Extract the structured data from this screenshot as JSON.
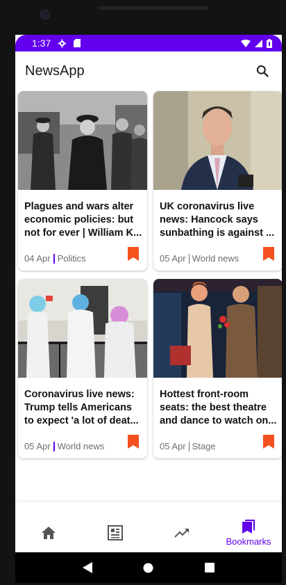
{
  "status_bar": {
    "time": "1:37",
    "icons": [
      "settings-icon",
      "sd-card-icon",
      "wifi-icon",
      "signal-icon",
      "battery-icon"
    ],
    "background": "#6200ee"
  },
  "app_bar": {
    "title": "NewsApp",
    "search_icon": "search-icon"
  },
  "articles": [
    {
      "title": "Plagues and wars alter economic policies: but not for ever | William K...",
      "date": "04 Apr",
      "category": "Politics",
      "image": "black-and-white photo of people in coats and hats",
      "bookmark_icon": "bookmark-icon"
    },
    {
      "title": "UK coronavirus live news: Hancock says sunbathing is against ...",
      "date": "05 Apr",
      "category": "World news",
      "image": "man in suit speaking outdoors",
      "bookmark_icon": "bookmark-icon"
    },
    {
      "title": "Coronavirus live news: Trump tells Americans to expect 'a lot of deat...",
      "date": "05 Apr",
      "category": "World news",
      "image": "workers in white protective suits sitting outside a building",
      "bookmark_icon": "bookmark-icon"
    },
    {
      "title": "Hottest front-room seats: the best theatre and dance to watch on...",
      "date": "05 Apr",
      "category": "Stage",
      "image": "two actors performing on a stage",
      "bookmark_icon": "bookmark-icon"
    }
  ],
  "bottom_nav": {
    "items": [
      {
        "icon": "home-icon",
        "label": ""
      },
      {
        "icon": "newspaper-icon",
        "label": ""
      },
      {
        "icon": "trending-icon",
        "label": ""
      },
      {
        "icon": "bookmarks-icon",
        "label": "Bookmarks",
        "active": true
      }
    ]
  },
  "system_nav": [
    "back-icon",
    "home-circle-icon",
    "recents-icon"
  ],
  "colors": {
    "primary": "#6200ee",
    "bookmark": "#f4511e",
    "meta_text": "#6e6e6e"
  }
}
